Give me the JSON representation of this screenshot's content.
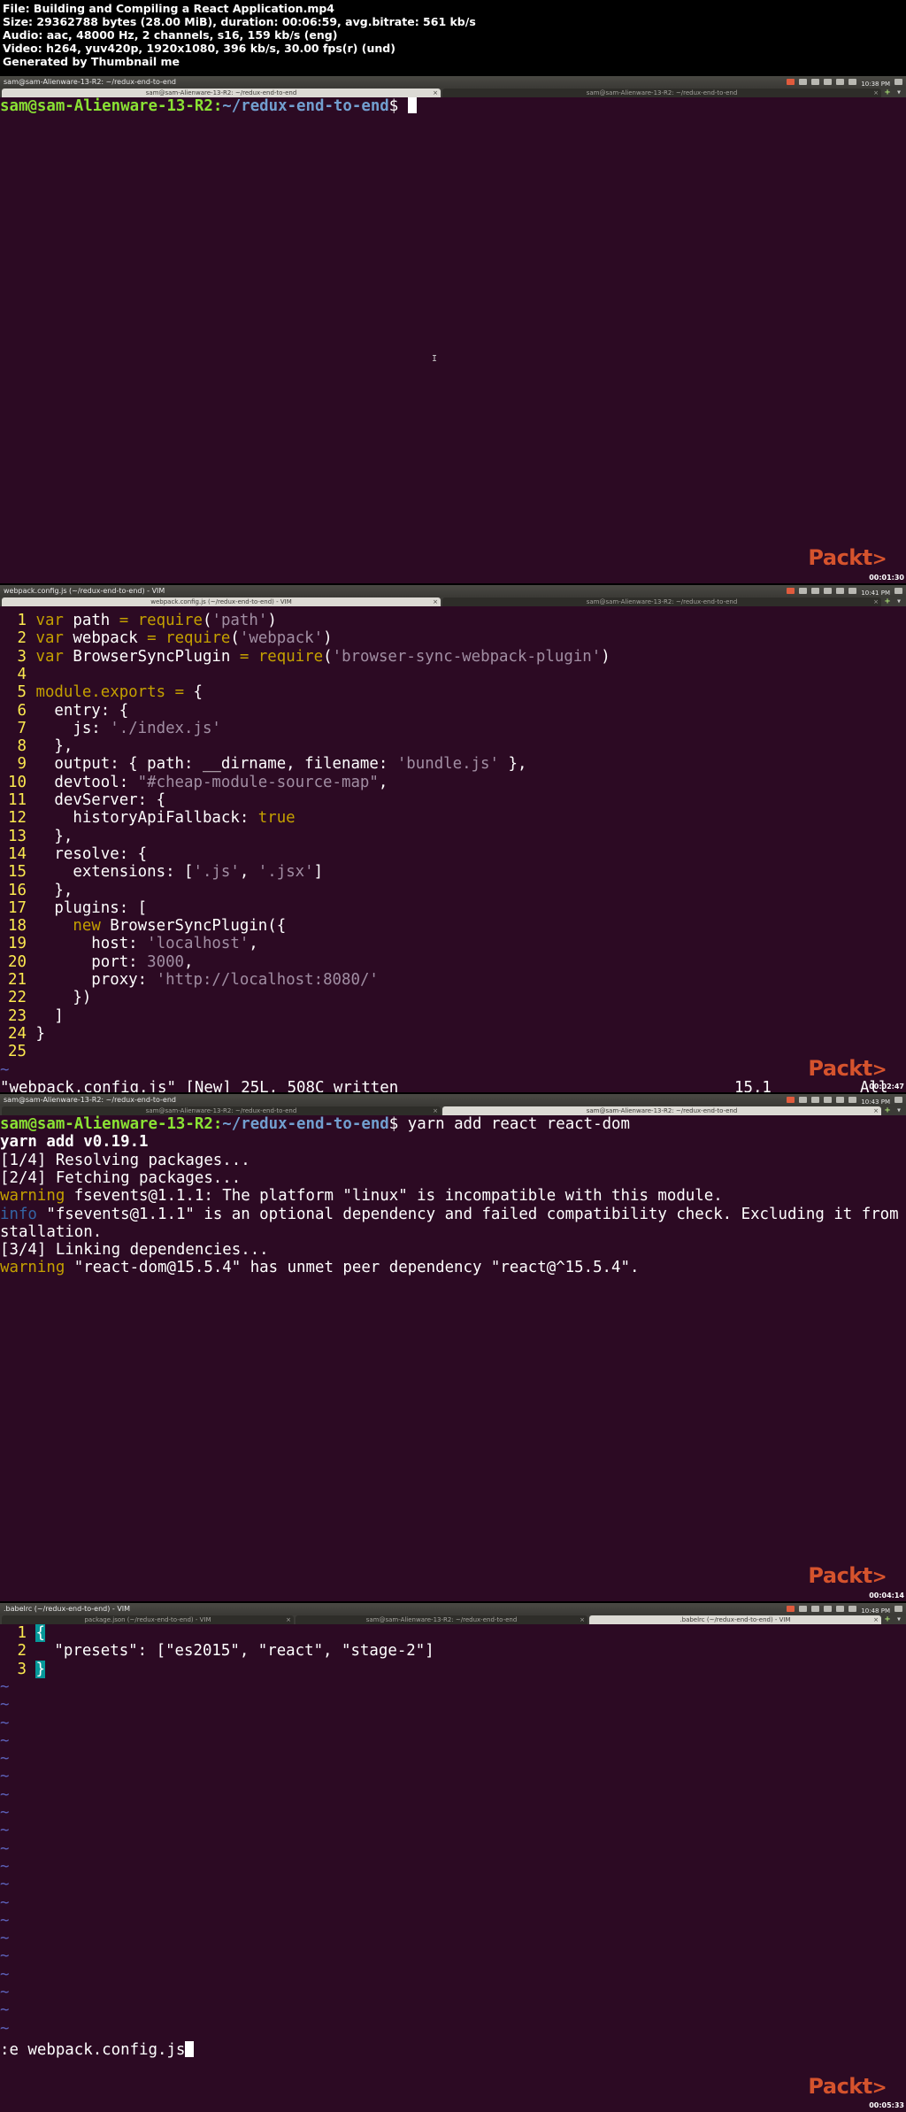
{
  "file_info": {
    "file": "File: Building and Compiling a React Application.mp4",
    "size": "Size: 29362788 bytes (28.00 MiB), duration: 00:06:59, avg.bitrate: 561 kb/s",
    "audio": "Audio: aac, 48000 Hz, 2 channels, s16, 159 kb/s (eng)",
    "video": "Video: h264, yuv420p, 1920x1080, 396 kb/s, 30.00 fps(r) (und)",
    "generator": "Generated by Thumbnail me"
  },
  "brand": "Packt",
  "frames": [
    {
      "window_title": "sam@sam-Alienware-13-R2: ~/redux-end-to-end",
      "clock": "10:38 PM",
      "timestamp": "00:01:30",
      "tabs": [
        "sam@sam-Alienware-13-R2: ~/redux-end-to-end",
        "sam@sam-Alienware-13-R2: ~/redux-end-to-end"
      ],
      "prompt_user": "sam@sam-Alienware-13-R2",
      "prompt_path": "~/redux-end-to-end"
    },
    {
      "window_title": "webpack.config.js (~/redux-end-to-end) - VIM",
      "clock": "10:41 PM",
      "timestamp": "00:02:47",
      "tabs": [
        "webpack.config.js (~/redux-end-to-end) - VIM",
        "sam@sam-Alienware-13-R2: ~/redux-end-to-end"
      ],
      "code": [
        "var path = require('path')",
        "var webpack = require('webpack')",
        "var BrowserSyncPlugin = require('browser-sync-webpack-plugin')",
        "",
        "module.exports = {",
        "  entry: {",
        "    js: './index.js'",
        "  },",
        "  output: { path: __dirname, filename: 'bundle.js' },",
        "  devtool: \"#cheap-module-source-map\",",
        "  devServer: {",
        "    historyApiFallback: true",
        "  },",
        "  resolve: {",
        "    extensions: ['.js', '.jsx']",
        "  },",
        "  plugins: [",
        "    new BrowserSyncPlugin({",
        "      host: 'localhost',",
        "      port: 3000,",
        "      proxy: 'http://localhost:8080/'",
        "    })",
        "  ]",
        "}",
        ""
      ],
      "status_message": "\"webpack.config.js\" [New] 25L, 508C written",
      "cursor_pos": "15,1",
      "scroll_pos": "All"
    },
    {
      "window_title": "sam@sam-Alienware-13-R2: ~/redux-end-to-end",
      "clock": "10:43 PM",
      "timestamp": "00:04:14",
      "tabs": [
        "sam@sam-Alienware-13-R2: ~/redux-end-to-end",
        "sam@sam-Alienware-13-R2: ~/redux-end-to-end"
      ],
      "prompt_user": "sam@sam-Alienware-13-R2",
      "prompt_path": "~/redux-end-to-end",
      "command": "yarn add react react-dom",
      "output": {
        "yarn_version": "yarn add v0.19.1",
        "step1": "[1/4] Resolving packages...",
        "step2": "[2/4] Fetching packages...",
        "warn1_tag": "warning",
        "warn1_text": " fsevents@1.1.1: The platform \"linux\" is incompatible with this module.",
        "info_tag": "info",
        "info_text": " \"fsevents@1.1.1\" is an optional dependency and failed compatibility check. Excluding it from in",
        "info_wrap": "stallation.",
        "step3": "[3/4] Linking dependencies...",
        "warn2_tag": "warning",
        "warn2_text": " \"react-dom@15.5.4\" has unmet peer dependency \"react@^15.5.4\"."
      }
    },
    {
      "window_title": ".babelrc (~/redux-end-to-end) - VIM",
      "clock": "10:48 PM",
      "timestamp": "00:05:33",
      "tabs": [
        "package.json (~/redux-end-to-end) - VIM",
        "sam@sam-Alienware-13-R2: ~/redux-end-to-end",
        ".babelrc (~/redux-end-to-end) - VIM",
        "sam@sam-Alienware-13-R2: ~/redux-end-to-end"
      ],
      "code_open": "{",
      "code_line2": "  \"presets\": [\"es2015\", \"react\", \"stage-2\"]",
      "code_close": "}",
      "command_line": ":e webpack.config.js"
    }
  ]
}
